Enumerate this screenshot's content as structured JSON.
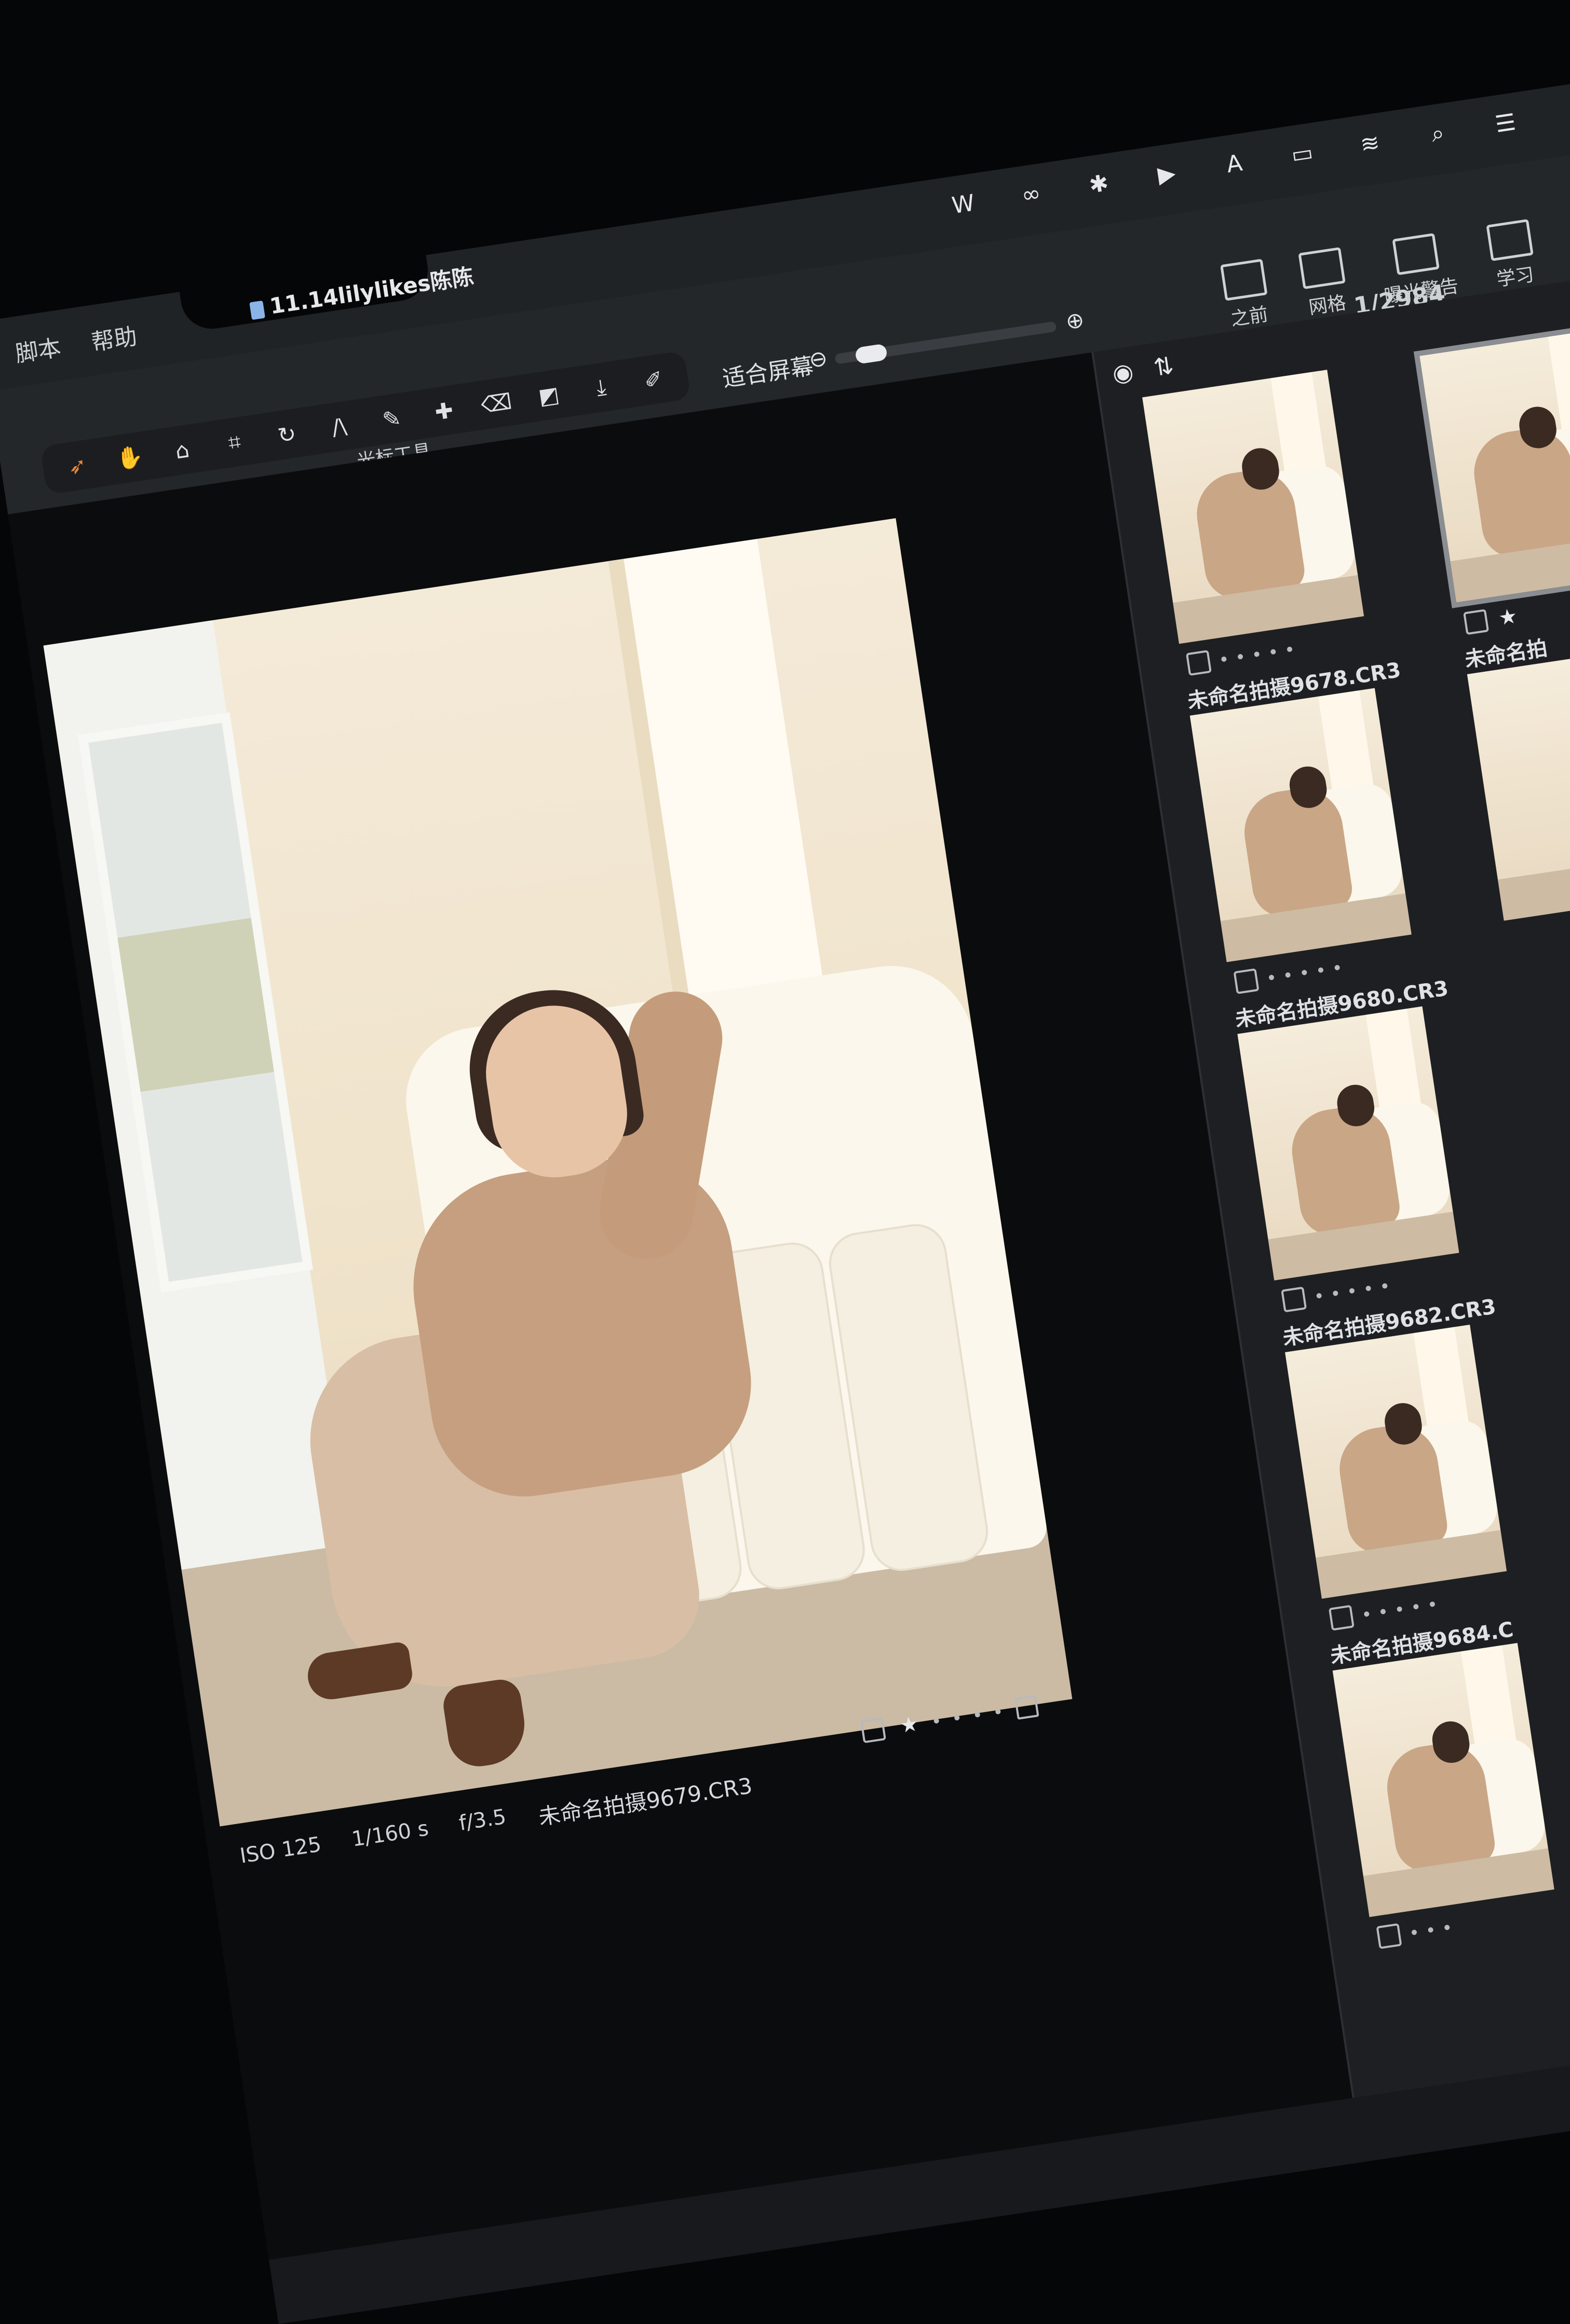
{
  "menubar": {
    "menus": [
      "脚本",
      "帮助"
    ],
    "document_title": "11.14lilylikes陈陈",
    "status_icons": [
      "wps-icon",
      "creative-cloud-icon",
      "bluetooth-icon",
      "play-icon",
      "input-method-icon",
      "battery-icon",
      "wifi-icon",
      "search-icon",
      "control-center-icon"
    ]
  },
  "toolbar": {
    "cursor_tools_label": "光标工具",
    "fit_label": "适合屏幕",
    "right_tools": [
      {
        "label": "之前",
        "icon": "before-after-icon"
      },
      {
        "label": "网格",
        "icon": "grid-icon"
      },
      {
        "label": "曝光警告",
        "icon": "exposure-warning-icon"
      },
      {
        "label": "学习",
        "icon": "learn-icon"
      }
    ],
    "counter": "1/2984"
  },
  "viewer": {
    "meta": [
      "ISO 125",
      "1/160 s",
      "f/3.5"
    ],
    "file_name": "未命名拍摄9679.CR3",
    "rating_stars": 1
  },
  "browser": {
    "thumbnails": [
      {
        "name": "未命名拍摄9678.CR3"
      },
      {
        "name": "未命名拍摄9680.CR3"
      },
      {
        "name": "未命名拍摄9682.CR3"
      },
      {
        "name": "未命名拍摄9684.C"
      },
      {
        "name": ""
      }
    ],
    "second_column_name": "未命名拍"
  }
}
